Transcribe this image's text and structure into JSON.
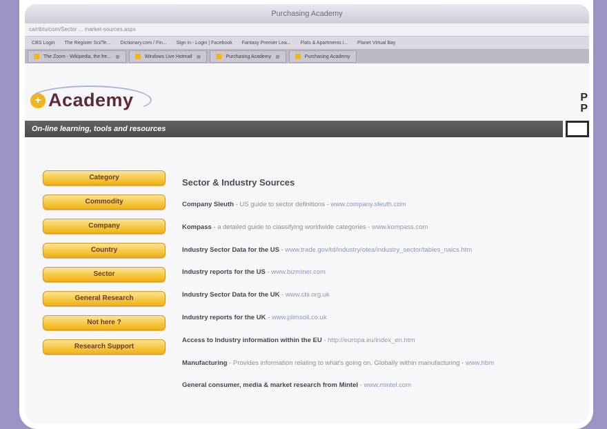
{
  "browser": {
    "window_title": "Purchasing Academy",
    "address": "ca/rtbtu/com/Sector ... market-sources.aspx",
    "bookmarks": [
      "CBS Login",
      "The Register Sci/Te...",
      "Dictionary.com / Fin...",
      "Sign in - Login | Facebook",
      "Fantasy Premier Lea...",
      "Flats & Apartments i...",
      "Planet Virtual Bay"
    ],
    "tabs": [
      {
        "label": "The Zoom - Wikipedia, the fre..."
      },
      {
        "label": "Windows Live Hotmail"
      },
      {
        "label": "Purchasing Academy"
      },
      {
        "label": "Purchasing Academy"
      }
    ]
  },
  "site": {
    "logo_mark": "+",
    "logo_text": "Academy",
    "right_edge": "P\nP",
    "strapline": "On-line learning, tools and resources"
  },
  "nav": [
    "Category",
    "Commodity",
    "Company",
    "Country",
    "Sector",
    "General Research",
    "Not here ?",
    "Research Support"
  ],
  "main": {
    "heading": "Sector & Industry Sources",
    "items": [
      {
        "title": "Company Sleuth",
        "desc": " - US guide to sector definitions - ",
        "url": "www.company.sleuth.com"
      },
      {
        "title": "Kompass",
        "desc": " - a detailed guide to classifying worldwide categories - ",
        "url": "www.kompass.com"
      },
      {
        "title": "Industry Sector Data for the US",
        "desc": " - ",
        "url": "www.trade.gov/td/industry/otea/industry_sector/tables_naics.htm"
      },
      {
        "title": "Industry reports for the US",
        "desc": " - ",
        "url": "www.bizminer.com"
      },
      {
        "title": "Industry Sector Data for the UK",
        "desc": " - ",
        "url": "www.cbi.org.uk"
      },
      {
        "title": "Industry reports for the UK",
        "desc": " - ",
        "url": "www.plimsoll.co.uk"
      },
      {
        "title": "Access to Industry information within the EU",
        "desc": " - ",
        "url": "http://europa.eu/index_en.htm"
      },
      {
        "title": "Manufacturing",
        "desc": " - Provides information relating to what's going on. Globally within manufacturing - ",
        "url": "www.hbm"
      },
      {
        "title": "General consumer, media & market research from Mintel",
        "desc": " - ",
        "url": "www.mintel.com"
      }
    ]
  }
}
